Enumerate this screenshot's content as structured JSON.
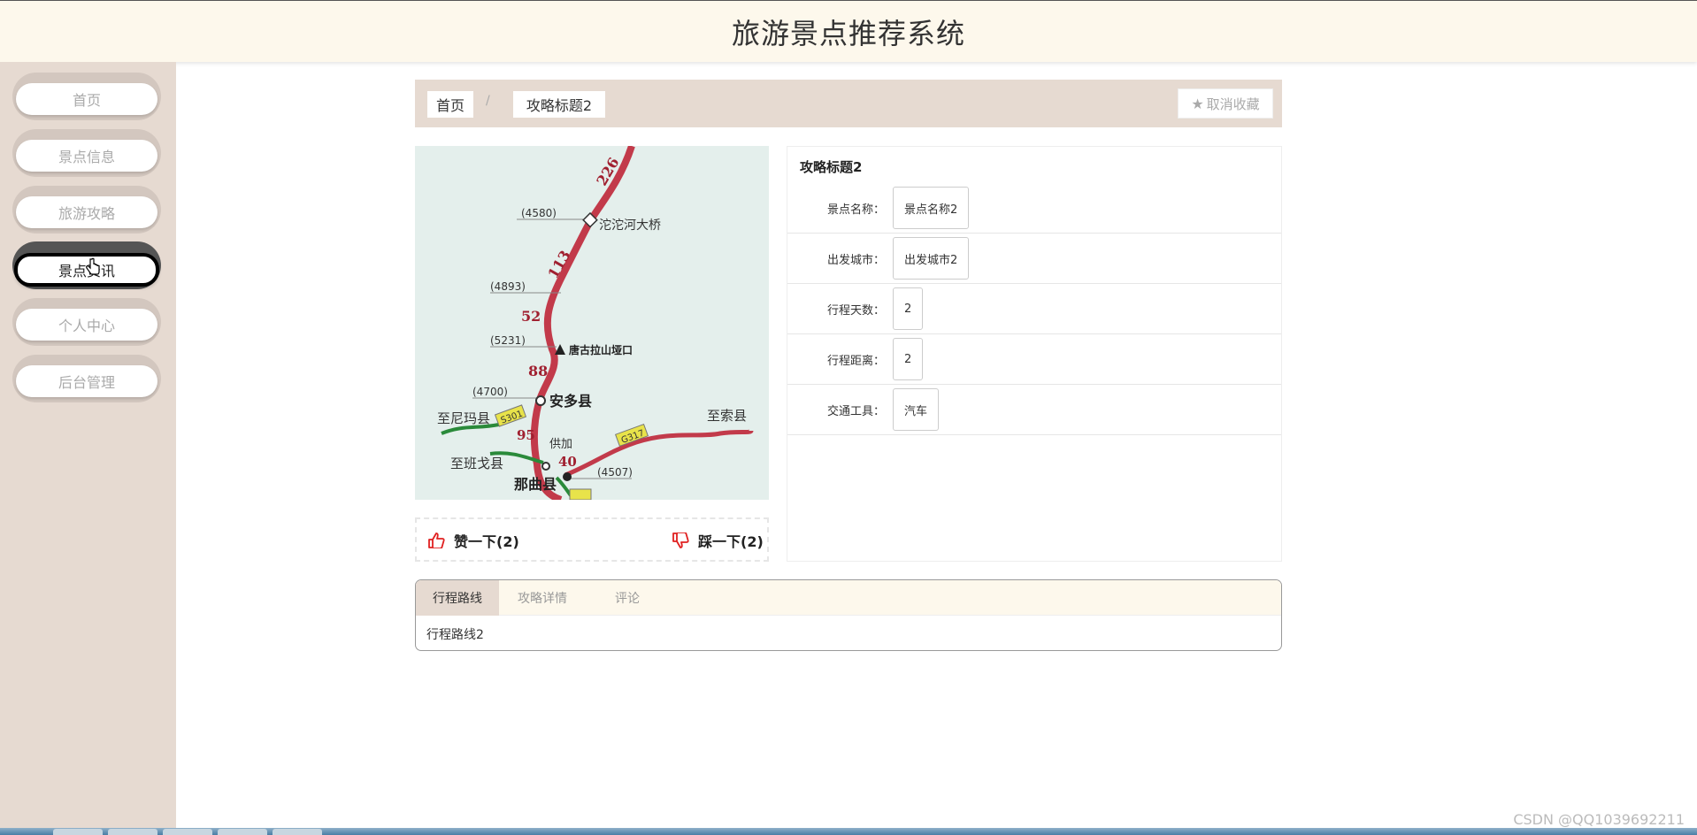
{
  "app": {
    "title": "旅游景点推荐系统"
  },
  "sidebar": {
    "items": [
      {
        "label": "首页"
      },
      {
        "label": "景点信息"
      },
      {
        "label": "旅游攻略"
      },
      {
        "label": "景点资讯"
      },
      {
        "label": "个人中心"
      },
      {
        "label": "后台管理"
      }
    ]
  },
  "breadcrumb": {
    "home": "首页",
    "separator": "/",
    "current": "攻略标题2",
    "fav_label": "取消收藏"
  },
  "map_image": {
    "labels": [
      "226",
      "(4580)",
      "沱沱河大桥",
      "113",
      "(4893)",
      "52",
      "(5231)",
      "唐古拉山垭口",
      "88",
      "(4700)",
      "安多县",
      "至尼玛县",
      "S301",
      "95",
      "供加",
      "G317",
      "至索县",
      "40",
      "至班戈县",
      "(4507)",
      "那曲县"
    ]
  },
  "votes": {
    "like_label": "赞一下(2)",
    "dislike_label": "踩一下(2)"
  },
  "detail": {
    "title": "攻略标题2",
    "fields": [
      {
        "label": "景点名称：",
        "value": "景点名称2"
      },
      {
        "label": "出发城市：",
        "value": "出发城市2"
      },
      {
        "label": "行程天数：",
        "value": "2"
      },
      {
        "label": "行程距离：",
        "value": "2"
      },
      {
        "label": "交通工具：",
        "value": "汽车"
      }
    ]
  },
  "tabs": {
    "items": [
      {
        "label": "行程路线"
      },
      {
        "label": "攻略详情"
      },
      {
        "label": "评论"
      }
    ],
    "active_content": "行程路线2"
  },
  "watermark": "CSDN @QQ1039692211",
  "colors": {
    "header_bg": "#fdf8ec",
    "sidebar_bg": "#e6dad1",
    "route_red": "#c23a4a",
    "accent_red": "#e02020"
  }
}
